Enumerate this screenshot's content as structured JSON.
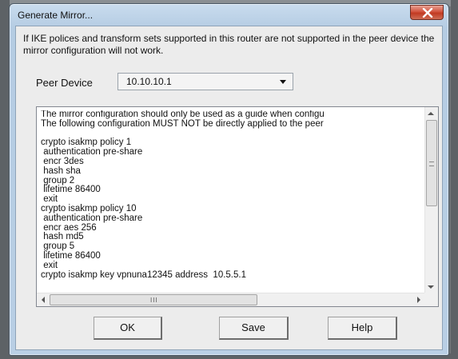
{
  "window": {
    "title": "Generate Mirror...",
    "close_icon": "close-icon"
  },
  "info_text": "If IKE polices and transform sets supported in this router are not supported in the peer device the mirror configuration will not work.",
  "peer_device": {
    "label": "Peer Device",
    "selected_value": "10.10.10.1"
  },
  "config_lines": [
    "The mirror configuration should only be used as a guide when configu",
    "The following configuration MUST NOT be directly applied to the peer",
    "",
    "crypto isakmp policy 1",
    " authentication pre-share",
    " encr 3des",
    " hash sha",
    " group 2",
    " lifetime 86400",
    " exit",
    "crypto isakmp policy 10",
    " authentication pre-share",
    " encr aes 256",
    " hash md5",
    " group 5",
    " lifetime 86400",
    " exit",
    "crypto isakmp key vpnuna12345 address  10.5.5.1"
  ],
  "scrollbar": {
    "h_thumb_grip": "III"
  },
  "buttons": {
    "ok": "OK",
    "save": "Save",
    "help": "Help"
  },
  "colors": {
    "title_gradient": "#b9cfe5",
    "close_button": "#c94a33",
    "client_background": "#ececec"
  }
}
